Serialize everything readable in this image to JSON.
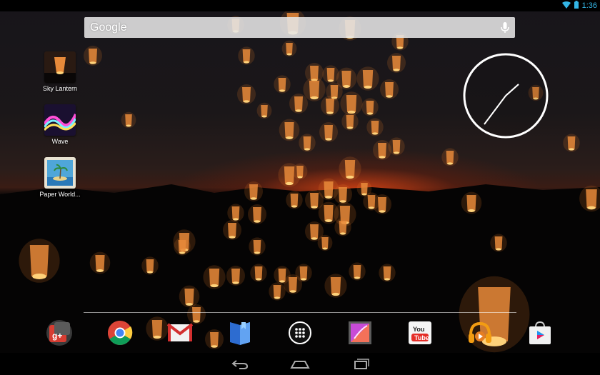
{
  "status_bar": {
    "time": "1:36",
    "icons": [
      "wifi-icon",
      "battery-icon"
    ]
  },
  "search": {
    "logo_text": "Google",
    "icon": "microphone-icon"
  },
  "shortcuts": [
    {
      "label": "Sky Lantern",
      "icon": "sky-lantern-icon"
    },
    {
      "label": "Wave",
      "icon": "wave-icon"
    },
    {
      "label": "Paper World...",
      "icon": "paper-world-icon"
    }
  ],
  "clock": {
    "type": "analog",
    "icon": "analog-clock"
  },
  "dock": {
    "apps": [
      {
        "name": "google-plus-icon"
      },
      {
        "name": "chrome-icon"
      },
      {
        "name": "gmail-icon"
      },
      {
        "name": "play-books-icon"
      },
      {
        "name": "all-apps-icon"
      },
      {
        "name": "gallery-icon"
      },
      {
        "name": "youtube-icon"
      },
      {
        "name": "play-music-icon"
      },
      {
        "name": "play-store-icon"
      }
    ],
    "youtube_text": "You Tube",
    "gplus_text": "g+"
  },
  "nav_bar": {
    "buttons": [
      "back-icon",
      "home-icon",
      "recent-apps-icon"
    ]
  },
  "colors": {
    "status_time": "#33b5e5",
    "lantern_glow": "#e8893a",
    "search_bar": "#e6e6e6"
  }
}
